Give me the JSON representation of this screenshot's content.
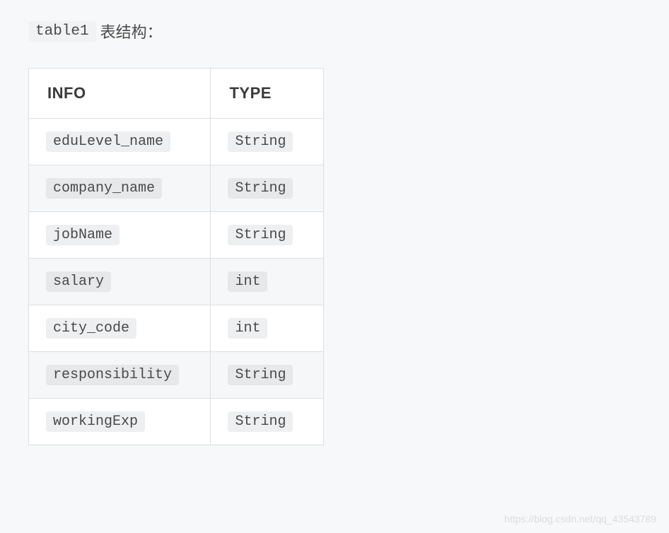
{
  "title": {
    "code": "table1",
    "text": "表结构："
  },
  "table": {
    "headers": {
      "info": "INFO",
      "type": "TYPE"
    },
    "rows": [
      {
        "info": "eduLevel_name",
        "type": "String"
      },
      {
        "info": "company_name",
        "type": "String"
      },
      {
        "info": "jobName",
        "type": "String"
      },
      {
        "info": "salary",
        "type": "int"
      },
      {
        "info": "city_code",
        "type": "int"
      },
      {
        "info": "responsibility",
        "type": "String"
      },
      {
        "info": "workingExp",
        "type": "String"
      }
    ]
  },
  "watermark": "https://blog.csdn.net/qq_43543789"
}
